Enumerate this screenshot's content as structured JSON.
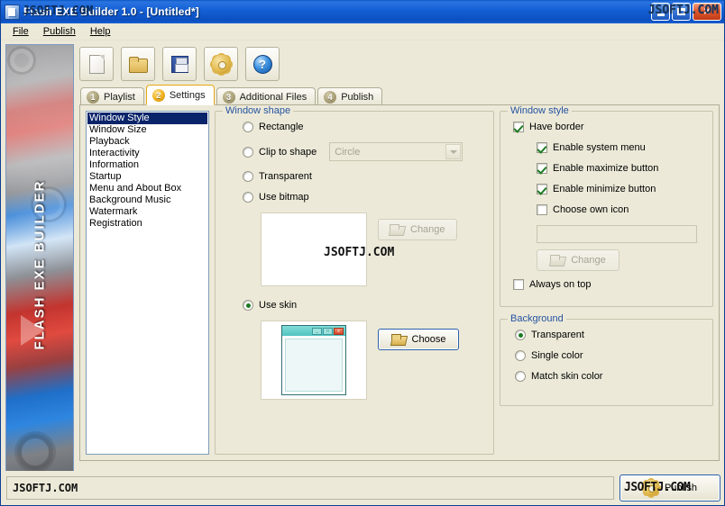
{
  "window": {
    "title": "Flash EXE Builder 1.0 - [Untitled*]",
    "app_icon": "app-icon",
    "controls": {
      "minimize": "–",
      "maximize": "□",
      "close": "✕"
    }
  },
  "watermark": {
    "text": "JSOFTJ.COM"
  },
  "menubar": {
    "items": [
      {
        "label": "File"
      },
      {
        "label": "Publish"
      },
      {
        "label": "Help"
      }
    ]
  },
  "banner": {
    "text": "FLASH EXE BUILDER"
  },
  "toolbar": {
    "buttons": [
      {
        "name": "new-document-icon",
        "label": "New"
      },
      {
        "name": "open-folder-icon",
        "label": "Open"
      },
      {
        "name": "save-floppy-icon",
        "label": "Save"
      },
      {
        "name": "settings-gear-icon",
        "label": "Settings"
      },
      {
        "name": "help-question-icon",
        "label": "Help"
      }
    ]
  },
  "tabs": [
    {
      "num": "1",
      "label": "Playlist",
      "active": false
    },
    {
      "num": "2",
      "label": "Settings",
      "active": true
    },
    {
      "num": "3",
      "label": "Additional Files",
      "active": false
    },
    {
      "num": "4",
      "label": "Publish",
      "active": false
    }
  ],
  "settings_list": {
    "items": [
      "Window Style",
      "Window Size",
      "Playback",
      "Interactivity",
      "Information",
      "Startup",
      "Menu and About Box",
      "Background Music",
      "Watermark",
      "Registration"
    ],
    "selected": "Window Style"
  },
  "window_shape": {
    "title": "Window shape",
    "options": [
      {
        "label": "Rectangle",
        "selected": false
      },
      {
        "label": "Clip to shape",
        "selected": false
      },
      {
        "label": "Transparent",
        "selected": false
      },
      {
        "label": "Use bitmap",
        "selected": false
      },
      {
        "label": "Use skin",
        "selected": true
      }
    ],
    "shape_combo": {
      "value": "Circle",
      "enabled": false
    },
    "bitmap_change_button": {
      "label": "Change",
      "enabled": false
    },
    "skin_choose_button": {
      "label": "Choose",
      "enabled": true
    }
  },
  "window_style": {
    "title": "Window style",
    "options": [
      {
        "label": "Have border",
        "checked": true
      },
      {
        "label": "Enable system menu",
        "checked": true
      },
      {
        "label": "Enable maximize button",
        "checked": true
      },
      {
        "label": "Enable minimize button",
        "checked": true
      },
      {
        "label": "Choose own icon",
        "checked": false
      },
      {
        "label": "Always on top",
        "checked": false
      }
    ],
    "icon_path_value": "",
    "icon_change_button": {
      "label": "Change",
      "enabled": false
    }
  },
  "background": {
    "title": "Background",
    "options": [
      {
        "label": "Transparent",
        "selected": true
      },
      {
        "label": "Single color",
        "selected": false
      },
      {
        "label": "Match skin color",
        "selected": false
      }
    ]
  },
  "statusbar": {
    "text": "JSOFTJ.COM",
    "publish_button": "Publish"
  },
  "colors": {
    "titlebar_blue": "#1561d6",
    "panel_beige": "#ece9d8",
    "group_title_blue": "#2553a0",
    "accent_orange": "#e6a817",
    "selection_blue": "#0a246a",
    "check_green": "#1c7a22",
    "skin_teal": "#4fc3c0"
  }
}
